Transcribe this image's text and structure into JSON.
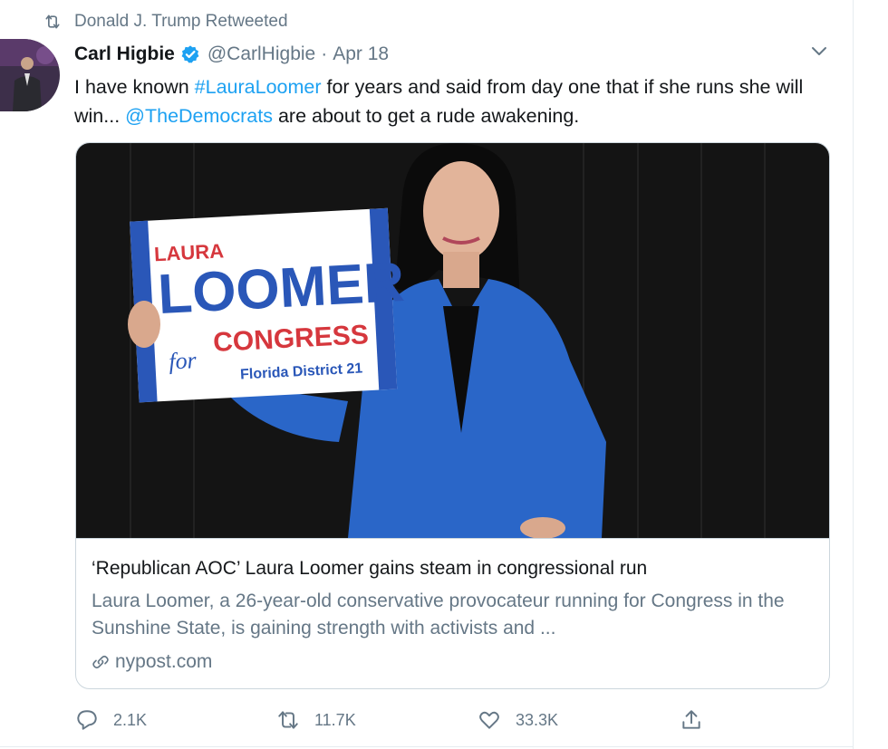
{
  "retweet_context": {
    "text": "Donald J. Trump Retweeted",
    "icon": "retweet-icon"
  },
  "author": {
    "display_name": "Carl Higbie",
    "handle": "@CarlHigbie",
    "separator": "·",
    "date": "Apr 18",
    "verified": true
  },
  "tweet": {
    "text_1": "I have known ",
    "hashtag": "#LauraLoomer",
    "text_2": " for years and said from day one that if she runs she will win...  ",
    "mention": "@TheDemocrats",
    "text_3": " are about to get a rude awakening."
  },
  "card": {
    "image_sign": {
      "line1": "LAURA",
      "line2": "LOOMER",
      "line3": "for",
      "line4": "CONGRESS",
      "line5": "Florida District 21"
    },
    "title": "‘Republican AOC’ Laura Loomer gains steam in congressional run",
    "description": "Laura Loomer, a 26-year-old conservative provocateur running for Congress in the Sunshine State, is gaining strength with activists and ...",
    "domain": "nypost.com"
  },
  "actions": {
    "reply_count": "2.1K",
    "retweet_count": "11.7K",
    "like_count": "33.3K"
  },
  "colors": {
    "link": "#1da1f2",
    "secondary_text": "#657786",
    "primary_text": "#14171a",
    "border": "#ccd6dd"
  }
}
